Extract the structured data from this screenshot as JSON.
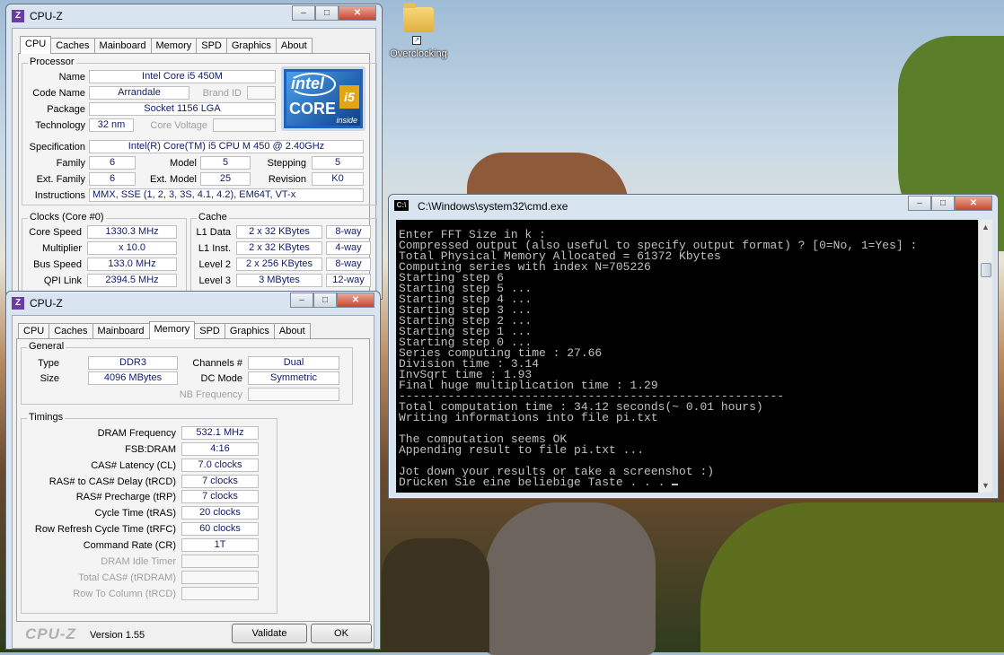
{
  "desktop": {
    "icon_label": "Overclocking"
  },
  "cpuz_top": {
    "title": "CPU-Z",
    "tabs": [
      "CPU",
      "Caches",
      "Mainboard",
      "Memory",
      "SPD",
      "Graphics",
      "About"
    ],
    "processor": {
      "group": "Processor",
      "name_label": "Name",
      "name": "Intel Core i5 450M",
      "codename_label": "Code Name",
      "codename": "Arrandale",
      "brandid_label": "Brand ID",
      "package_label": "Package",
      "package": "Socket 1156 LGA",
      "technology_label": "Technology",
      "technology": "32 nm",
      "corevoltage_label": "Core Voltage",
      "spec_label": "Specification",
      "spec": "Intel(R) Core(TM) i5 CPU      M 450  @ 2.40GHz",
      "family_label": "Family",
      "family": "6",
      "model_label": "Model",
      "model": "5",
      "stepping_label": "Stepping",
      "stepping": "5",
      "extfamily_label": "Ext. Family",
      "extfamily": "6",
      "extmodel_label": "Ext. Model",
      "extmodel": "25",
      "revision_label": "Revision",
      "revision": "K0",
      "instr_label": "Instructions",
      "instr": "MMX, SSE (1, 2, 3, 3S, 4.1, 4.2), EM64T, VT-x"
    },
    "logo": {
      "brand": "intel",
      "core": "CORE",
      "tier": "i5",
      "inside": "inside"
    },
    "clocks": {
      "group": "Clocks (Core #0)",
      "corespeed_label": "Core Speed",
      "corespeed": "1330.3 MHz",
      "multiplier_label": "Multiplier",
      "multiplier": "x 10.0",
      "busspeed_label": "Bus Speed",
      "busspeed": "133.0 MHz",
      "qpi_label": "QPI Link",
      "qpi": "2394.5 MHz"
    },
    "cache": {
      "group": "Cache",
      "l1d_label": "L1 Data",
      "l1d": "2 x 32 KBytes",
      "l1d_way": "8-way",
      "l1i_label": "L1 Inst.",
      "l1i": "2 x 32 KBytes",
      "l1i_way": "4-way",
      "l2_label": "Level 2",
      "l2": "2 x 256 KBytes",
      "l2_way": "8-way",
      "l3_label": "Level 3",
      "l3": "3 MBytes",
      "l3_way": "12-way"
    }
  },
  "cpuz_mem": {
    "title": "CPU-Z",
    "tabs": [
      "CPU",
      "Caches",
      "Mainboard",
      "Memory",
      "SPD",
      "Graphics",
      "About"
    ],
    "general": {
      "group": "General",
      "type_label": "Type",
      "type": "DDR3",
      "channels_label": "Channels #",
      "channels": "Dual",
      "size_label": "Size",
      "size": "4096 MBytes",
      "dcmode_label": "DC Mode",
      "dcmode": "Symmetric",
      "nbfreq_label": "NB Frequency"
    },
    "timings": {
      "group": "Timings",
      "rows": [
        {
          "label": "DRAM Frequency",
          "value": "532.1 MHz"
        },
        {
          "label": "FSB:DRAM",
          "value": "4:16"
        },
        {
          "label": "CAS# Latency (CL)",
          "value": "7.0 clocks"
        },
        {
          "label": "RAS# to CAS# Delay (tRCD)",
          "value": "7 clocks"
        },
        {
          "label": "RAS# Precharge (tRP)",
          "value": "7 clocks"
        },
        {
          "label": "Cycle Time (tRAS)",
          "value": "20 clocks"
        },
        {
          "label": "Row Refresh Cycle Time (tRFC)",
          "value": "60 clocks"
        },
        {
          "label": "Command Rate (CR)",
          "value": "1T"
        },
        {
          "label": "DRAM Idle Timer",
          "value": ""
        },
        {
          "label": "Total CAS# (tRDRAM)",
          "value": ""
        },
        {
          "label": "Row To Column (tRCD)",
          "value": ""
        }
      ]
    },
    "footer": {
      "logo": "CPU-Z",
      "version": "Version 1.55",
      "validate": "Validate",
      "ok": "OK"
    }
  },
  "cmd": {
    "title": "C:\\Windows\\system32\\cmd.exe",
    "lines": [
      "Enter FFT Size in k :",
      "Compressed output (also useful to specify output format) ? [0=No, 1=Yes] :",
      "Total Physical Memory Allocated = 61372 Kbytes",
      "Computing series with index N=705226",
      "Starting step 6",
      "Starting step 5 ...",
      "Starting step 4 ...",
      "Starting step 3 ...",
      "Starting step 2 ...",
      "Starting step 1 ...",
      "Starting step 0 ...",
      "Series computing time : 27.66",
      "Division time : 3.14",
      "InvSqrt time : 1.93",
      "Final huge multiplication time : 1.29",
      "-------------------------------------------------------",
      "Total computation time : 34.12 seconds(~ 0.01 hours)",
      "Writing informations into file pi.txt",
      "",
      "The computation seems OK",
      "Appending result to file pi.txt ...",
      "",
      "Jot down your results or take a screenshot :)",
      "Drücken Sie eine beliebige Taste . . . "
    ]
  }
}
